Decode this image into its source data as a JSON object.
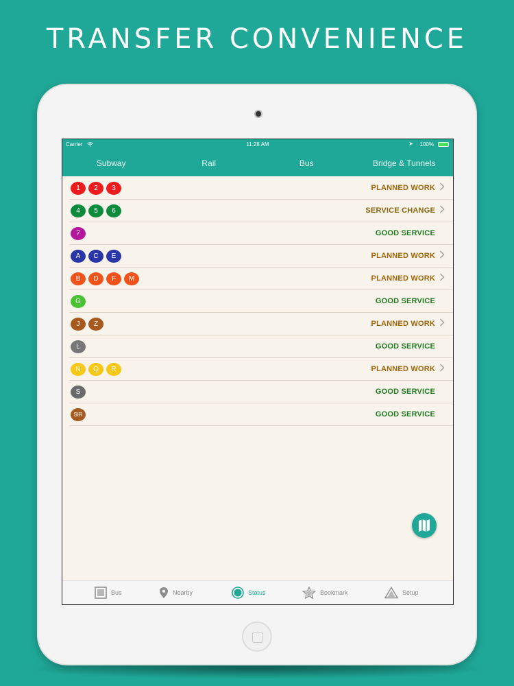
{
  "headline": "TRANSFER CONVENIENCE",
  "status_bar": {
    "carrier": "Carrier",
    "time": "11:28 AM",
    "battery": "100%"
  },
  "top_tabs": [
    "Subway",
    "Rail",
    "Bus",
    "Bridge & Tunnels"
  ],
  "colors": {
    "accent": "#1fa898",
    "planned_work": "#a0640a",
    "service_change": "#8b6410",
    "good_service": "#1f7a1f"
  },
  "rows": [
    {
      "lines": [
        {
          "label": "1",
          "color": "#ee1c1c"
        },
        {
          "label": "2",
          "color": "#ee1c1c"
        },
        {
          "label": "3",
          "color": "#ee1c1c"
        }
      ],
      "status": "PLANNED WORK",
      "status_type": "planned_work",
      "chevron": true
    },
    {
      "lines": [
        {
          "label": "4",
          "color": "#0d8a3c"
        },
        {
          "label": "5",
          "color": "#0d8a3c"
        },
        {
          "label": "6",
          "color": "#0d8a3c"
        }
      ],
      "status": "SERVICE CHANGE",
      "status_type": "service_change",
      "chevron": true
    },
    {
      "lines": [
        {
          "label": "7",
          "color": "#b5169e"
        }
      ],
      "status": "GOOD SERVICE",
      "status_type": "good_service",
      "chevron": false
    },
    {
      "lines": [
        {
          "label": "A",
          "color": "#2a35a8"
        },
        {
          "label": "C",
          "color": "#2a35a8"
        },
        {
          "label": "E",
          "color": "#2a35a8"
        }
      ],
      "status": "PLANNED WORK",
      "status_type": "planned_work",
      "chevron": true
    },
    {
      "lines": [
        {
          "label": "B",
          "color": "#f0531a"
        },
        {
          "label": "D",
          "color": "#f0531a"
        },
        {
          "label": "F",
          "color": "#f0531a"
        },
        {
          "label": "M",
          "color": "#f0531a"
        }
      ],
      "status": "PLANNED WORK",
      "status_type": "planned_work",
      "chevron": true
    },
    {
      "lines": [
        {
          "label": "G",
          "color": "#49c233"
        }
      ],
      "status": "GOOD SERVICE",
      "status_type": "good_service",
      "chevron": false
    },
    {
      "lines": [
        {
          "label": "J",
          "color": "#a65a1f"
        },
        {
          "label": "Z",
          "color": "#a65a1f"
        }
      ],
      "status": "PLANNED WORK",
      "status_type": "planned_work",
      "chevron": true
    },
    {
      "lines": [
        {
          "label": "L",
          "color": "#777777"
        }
      ],
      "status": "GOOD SERVICE",
      "status_type": "good_service",
      "chevron": false
    },
    {
      "lines": [
        {
          "label": "N",
          "color": "#f7c815"
        },
        {
          "label": "Q",
          "color": "#f7c815"
        },
        {
          "label": "R",
          "color": "#f7c815"
        }
      ],
      "status": "PLANNED WORK",
      "status_type": "planned_work",
      "chevron": true
    },
    {
      "lines": [
        {
          "label": "S",
          "color": "#6a6a6a"
        }
      ],
      "status": "GOOD SERVICE",
      "status_type": "good_service",
      "chevron": false
    },
    {
      "lines": [
        {
          "label": "SIR",
          "color": "#a65a1f"
        }
      ],
      "status": "GOOD SERVICE",
      "status_type": "good_service",
      "chevron": false
    }
  ],
  "bottom_tabs": [
    {
      "label": "Bus",
      "icon": "bus-square-icon",
      "active": false
    },
    {
      "label": "Nearby",
      "icon": "location-pin-icon",
      "active": false
    },
    {
      "label": "Status",
      "icon": "status-circle-icon",
      "active": true
    },
    {
      "label": "Bookmark",
      "icon": "star-icon",
      "active": false
    },
    {
      "label": "Setup",
      "icon": "triangle-icon",
      "active": false
    }
  ],
  "fab_icon": "map-icon"
}
